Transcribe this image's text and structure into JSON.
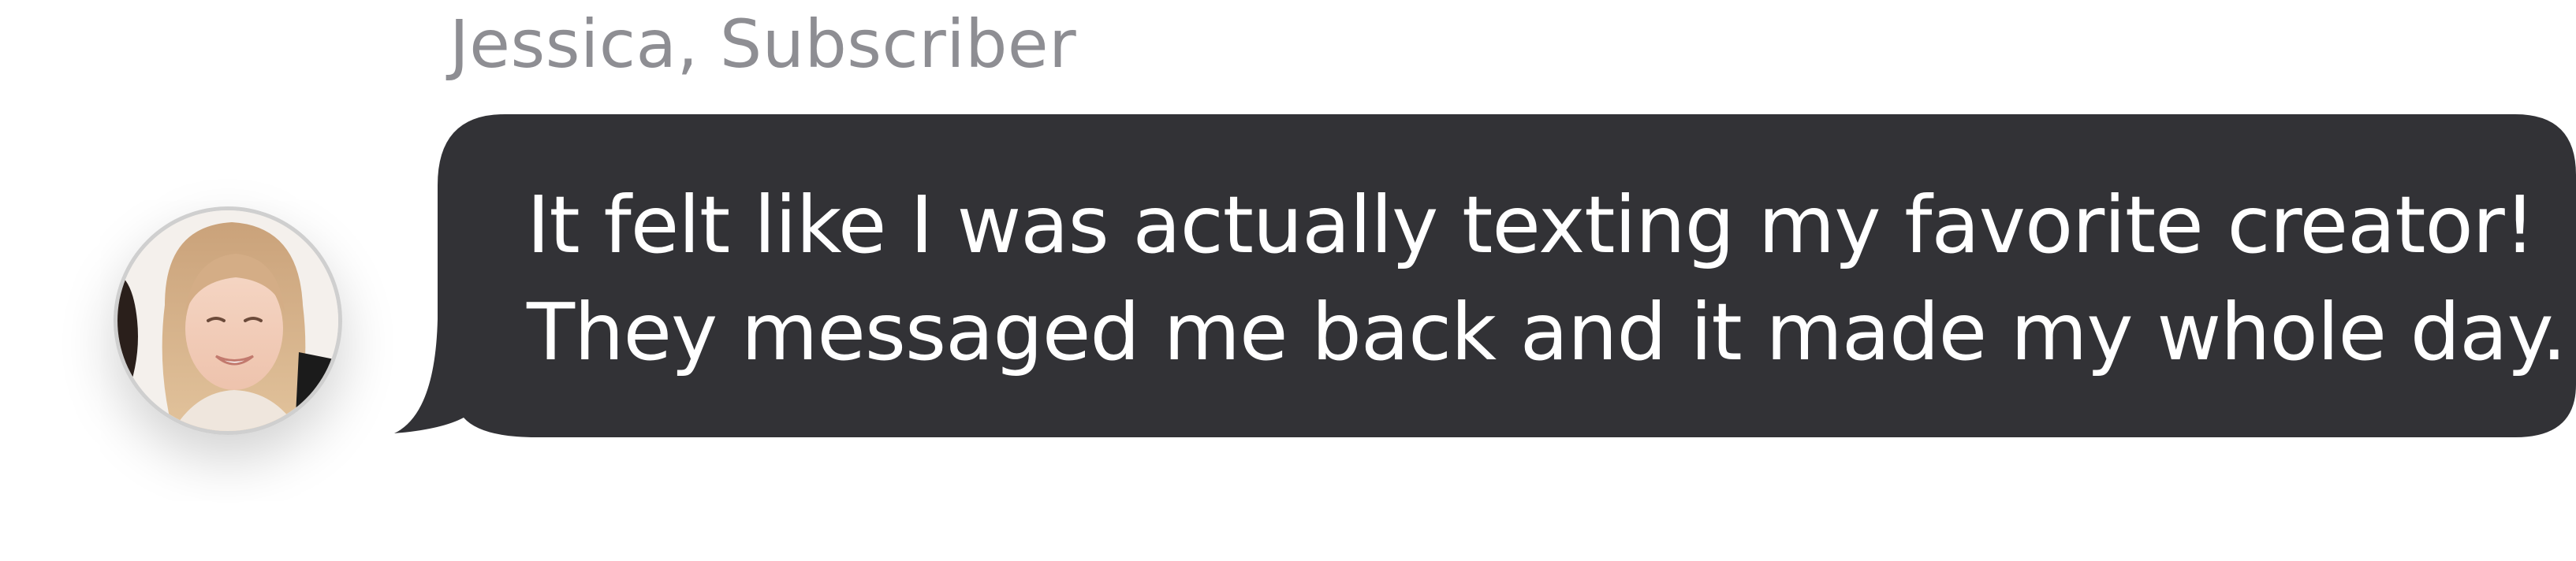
{
  "sender": {
    "label": "Jessica, Subscriber"
  },
  "message": {
    "lines": [
      "It felt like I was actually texting my favorite creator!",
      "They messaged me back and it made my whole day."
    ]
  },
  "avatar": {
    "icon": "user-photo-avatar"
  },
  "colors": {
    "bubble": "#323236",
    "message_text": "#ffffff",
    "sender_text": "#8e8e93",
    "background": "#ffffff"
  }
}
